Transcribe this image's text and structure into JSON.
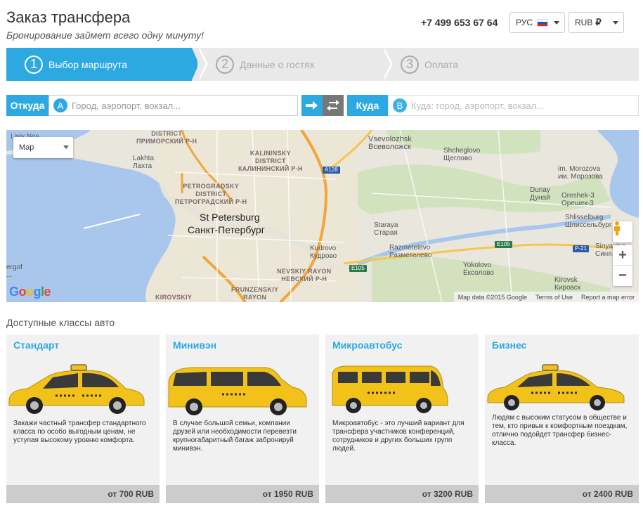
{
  "header": {
    "title": "Заказ трансфера",
    "subtitle": "Бронирование займет всего одну минуту!",
    "phone": "+7 499 653 67 64",
    "language": "РУС",
    "currency": "RUB",
    "currency_symbol": "₽"
  },
  "steps": [
    {
      "number": "1",
      "label": "Выбор маршрута",
      "active": true
    },
    {
      "number": "2",
      "label": "Данные о гостях",
      "active": false
    },
    {
      "number": "3",
      "label": "Оплата",
      "active": false
    }
  ],
  "route": {
    "from_label": "Откуда",
    "from_marker": "A",
    "from_placeholder": "Город, аэропорт, вокзал...",
    "swap_icon": "arrow-right-icon",
    "to_label": "Куда",
    "to_marker": "B",
    "to_placeholder": "Куда: город, аэропорт, вокзал..."
  },
  "map": {
    "type_selector": "Map",
    "zoom_in": "+",
    "zoom_out": "−",
    "attribution": "Map data ©2015 Google",
    "terms": "Terms of Use",
    "report": "Report a map error",
    "logo": "Google",
    "labels": {
      "city_en": "St Petersburg",
      "city_ru": "Санкт-Петербург",
      "vsevolozhsk_en": "Vsevolozhsk",
      "vsevolozhsk_ru": "Всеволожск",
      "shcheglovo_en": "Shcheglovo",
      "shcheglovo_ru": "Щеглово",
      "morozova_en": "im. Morozova",
      "morozova_ru": "им. Морозова",
      "dunay_en": "Dunay",
      "dunay_ru": "Дунай",
      "oreshek_en": "Oreshek-3",
      "oreshek_ru": "Орешек-3",
      "shlisselburg_en": "Shlisselburg",
      "shlisselburg_ru": "Шлиссельбург",
      "staraya_en": "Staraya",
      "staraya_ru": "Старая",
      "razmetelevo_en": "Razmetelevo",
      "razmetelevo_ru": "Разметелево",
      "kudrovo_en": "Kudrovo",
      "kudrovo_ru": "Кудрово",
      "yokolovo_en": "Yokolovo",
      "yokolovo_ru": "Ёксолово",
      "kirovsk_en": "Kirovsk",
      "kirovsk_ru": "Кировск",
      "sinyavino_en": "Sinyavino",
      "sinyavino_ru": "Синя...",
      "lakhta_en": "Lakhta",
      "lakhta_ru": "Лахта",
      "nos_en": "Lisiy Nos",
      "nos_ru": "...",
      "primorsky": "DISTRICT\nПРИМОРСКИЙ Р-Н",
      "kalininsky": "KALININSKY\nDISTRICT\nКАЛИНИНСКИЙ Р-Н",
      "petrogradsky": "PETROGRADSKY\nDISTRICT\nПЕТРОГРАДСКИЙ Р-Н",
      "nevsky": "NEVSKIY RAYON\nНЕВСКИЙ Р-Н",
      "frunzensky": "FRUNZENSKIY\nRAYON",
      "kirovsky": "KIROVSKIY",
      "ergof": "ergof\n...",
      "a128": "A128",
      "e105a": "E105",
      "e105b": "E105",
      "r21": "P-21"
    }
  },
  "classes": {
    "title": "Доступные классы авто",
    "items": [
      {
        "name": "Стандарт",
        "desc": "Закажи частный трансфер стандартного класса по особо выгодным ценам, не уступая высокому уровню комфорта.",
        "price": "от 700 RUB"
      },
      {
        "name": "Минивэн",
        "desc": "В случае большой семьи, компании друзей или необходимости перевезти крупногабаритный багаж забронируй минивэн.",
        "price": "от 1950 RUB"
      },
      {
        "name": "Микроавтобус",
        "desc": "Микроавтобус - это лучший вариант для трансфера участников конференций, сотрудников и других больших групп людей.",
        "price": "от 3200 RUB"
      },
      {
        "name": "Бизнес",
        "desc": "Людям с высоким статусом в обществе и тем, кто привык к комфортным поездкам, отлично подойдет трансфер бизнес-класса.",
        "price": "от 2400 RUB"
      }
    ]
  },
  "colors": {
    "accent": "#2ca9e1",
    "taxi_yellow": "#f2c21b"
  }
}
